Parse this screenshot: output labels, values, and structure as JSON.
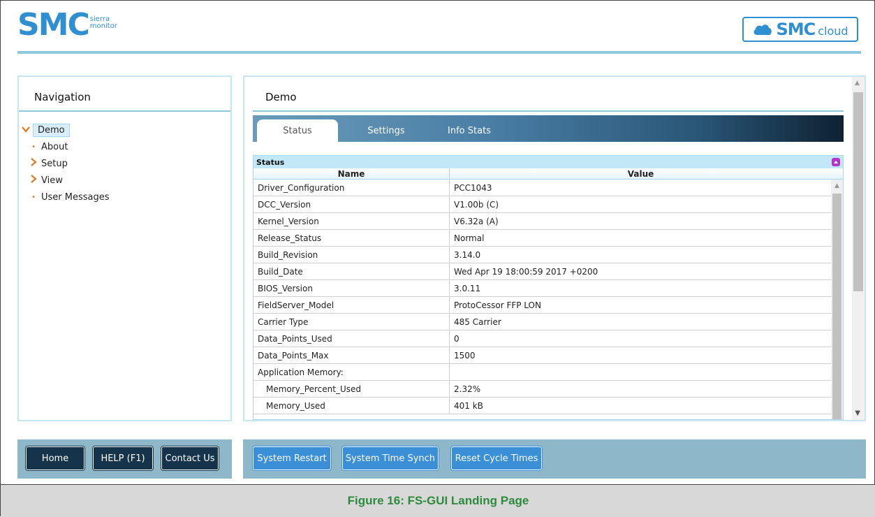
{
  "header": {
    "logo_text": "SMC",
    "logo_sub_line1": "sierra",
    "logo_sub_line2": "monitor",
    "cloud_button_word": "SMC",
    "cloud_button_suffix": "cloud"
  },
  "navigation": {
    "title": "Navigation",
    "items": [
      {
        "label": "Demo",
        "type": "expanded",
        "selected": true
      },
      {
        "label": "About",
        "type": "leaf"
      },
      {
        "label": "Setup",
        "type": "collapsed"
      },
      {
        "label": "View",
        "type": "collapsed"
      },
      {
        "label": "User Messages",
        "type": "leaf"
      }
    ]
  },
  "main": {
    "title": "Demo",
    "tabs": [
      {
        "label": "Status",
        "active": true
      },
      {
        "label": "Settings",
        "active": false
      },
      {
        "label": "Info Stats",
        "active": false
      }
    ],
    "status_section": {
      "title": "Status",
      "columns": [
        "Name",
        "Value"
      ],
      "rows": [
        {
          "name": "Driver_Configuration",
          "value": "PCC1043"
        },
        {
          "name": "DCC_Version",
          "value": "V1.00b (C)"
        },
        {
          "name": "Kernel_Version",
          "value": "V6.32a (A)"
        },
        {
          "name": "Release_Status",
          "value": "Normal"
        },
        {
          "name": "Build_Revision",
          "value": "3.14.0"
        },
        {
          "name": "Build_Date",
          "value": "Wed Apr 19 18:00:59 2017 +0200"
        },
        {
          "name": "BIOS_Version",
          "value": "3.0.11"
        },
        {
          "name": "FieldServer_Model",
          "value": "ProtoCessor FFP LON"
        },
        {
          "name": "Carrier Type",
          "value": "485 Carrier"
        },
        {
          "name": "Data_Points_Used",
          "value": "0"
        },
        {
          "name": "Data_Points_Max",
          "value": "1500"
        },
        {
          "name": "Application Memory:",
          "value": ""
        },
        {
          "name": "Memory_Percent_Used",
          "value": "2.32%"
        },
        {
          "name": "Memory_Used",
          "value": "401 kB"
        }
      ]
    }
  },
  "footer": {
    "left_buttons": [
      "Home",
      "HELP (F1)",
      "Contact Us"
    ],
    "right_buttons": [
      "System Restart",
      "System Time Synch",
      "Reset Cycle Times"
    ]
  },
  "caption": "Figure 16: FS-GUI Landing Page",
  "colors": {
    "brand_blue": "#2f8fd0",
    "accent_orange": "#e8781e",
    "dark_button": "#15334a",
    "blue_button": "#3a8fd6",
    "footer_bar": "#8fb7ca",
    "caption_green": "#2e8a3c"
  },
  "icons": {
    "expanded": "chevron-down-icon",
    "collapsed": "chevron-right-icon",
    "leaf": "bullet-icon",
    "collapse_section": "collapse-icon"
  }
}
